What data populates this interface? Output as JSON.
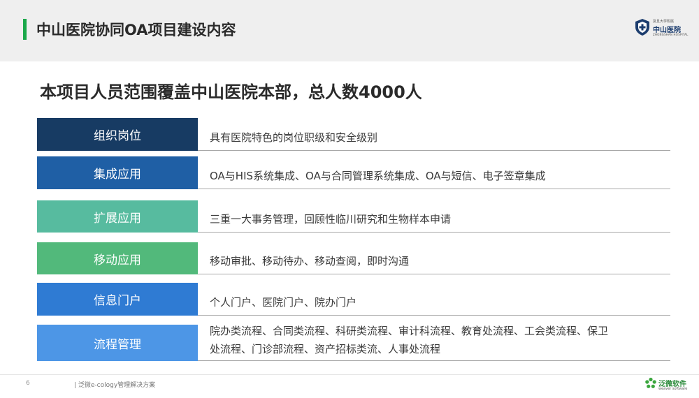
{
  "header": {
    "title": "中山医院协同OA项目建设内容",
    "accent_color": "#1aa84a",
    "logo": {
      "sub": "复旦大学附属",
      "name": "中山医院",
      "en": "ZHONGSHAN HOSPITAL",
      "icon": "hospital-shield-icon"
    }
  },
  "headline": "本项目人员范围覆盖中山医院本部，总人数4000人",
  "rows": [
    {
      "label": "组织岗位",
      "color": "#173b63",
      "lines": [
        "具有医院特色的岗位职级和安全级别"
      ]
    },
    {
      "label": "集成应用",
      "color": "#1f5fa5",
      "lines": [
        "OA与HIS系统集成、OA与合同管理系统集成、OA与短信、电子签章集成"
      ]
    },
    {
      "label": "扩展应用",
      "color": "#57bb9f",
      "lines": [
        "三重一大事务管理，回顾性临川研究和生物样本申请"
      ]
    },
    {
      "label": "移动应用",
      "color": "#52b97b",
      "lines": [
        "移动审批、移动待办、移动查阅，即时沟通"
      ]
    },
    {
      "label": "信息门户",
      "color": "#2f7bd3",
      "lines": [
        "个人门户、医院门户、院办门户"
      ]
    },
    {
      "label": "流程管理",
      "color": "#4d96e6",
      "lines": [
        "院办类流程、合同类流程、科研类流程、审计科流程、教育处流程、工会类流程、保卫",
        "处流程、门诊部流程、资产招标类流、人事处流程"
      ]
    }
  ],
  "footer": {
    "page_number": "6",
    "text": "| 泛微e-cology管理解决方案",
    "brand": "泛微软件",
    "brand_en": "weaver software",
    "brand_icon": "weaver-flower-icon"
  }
}
